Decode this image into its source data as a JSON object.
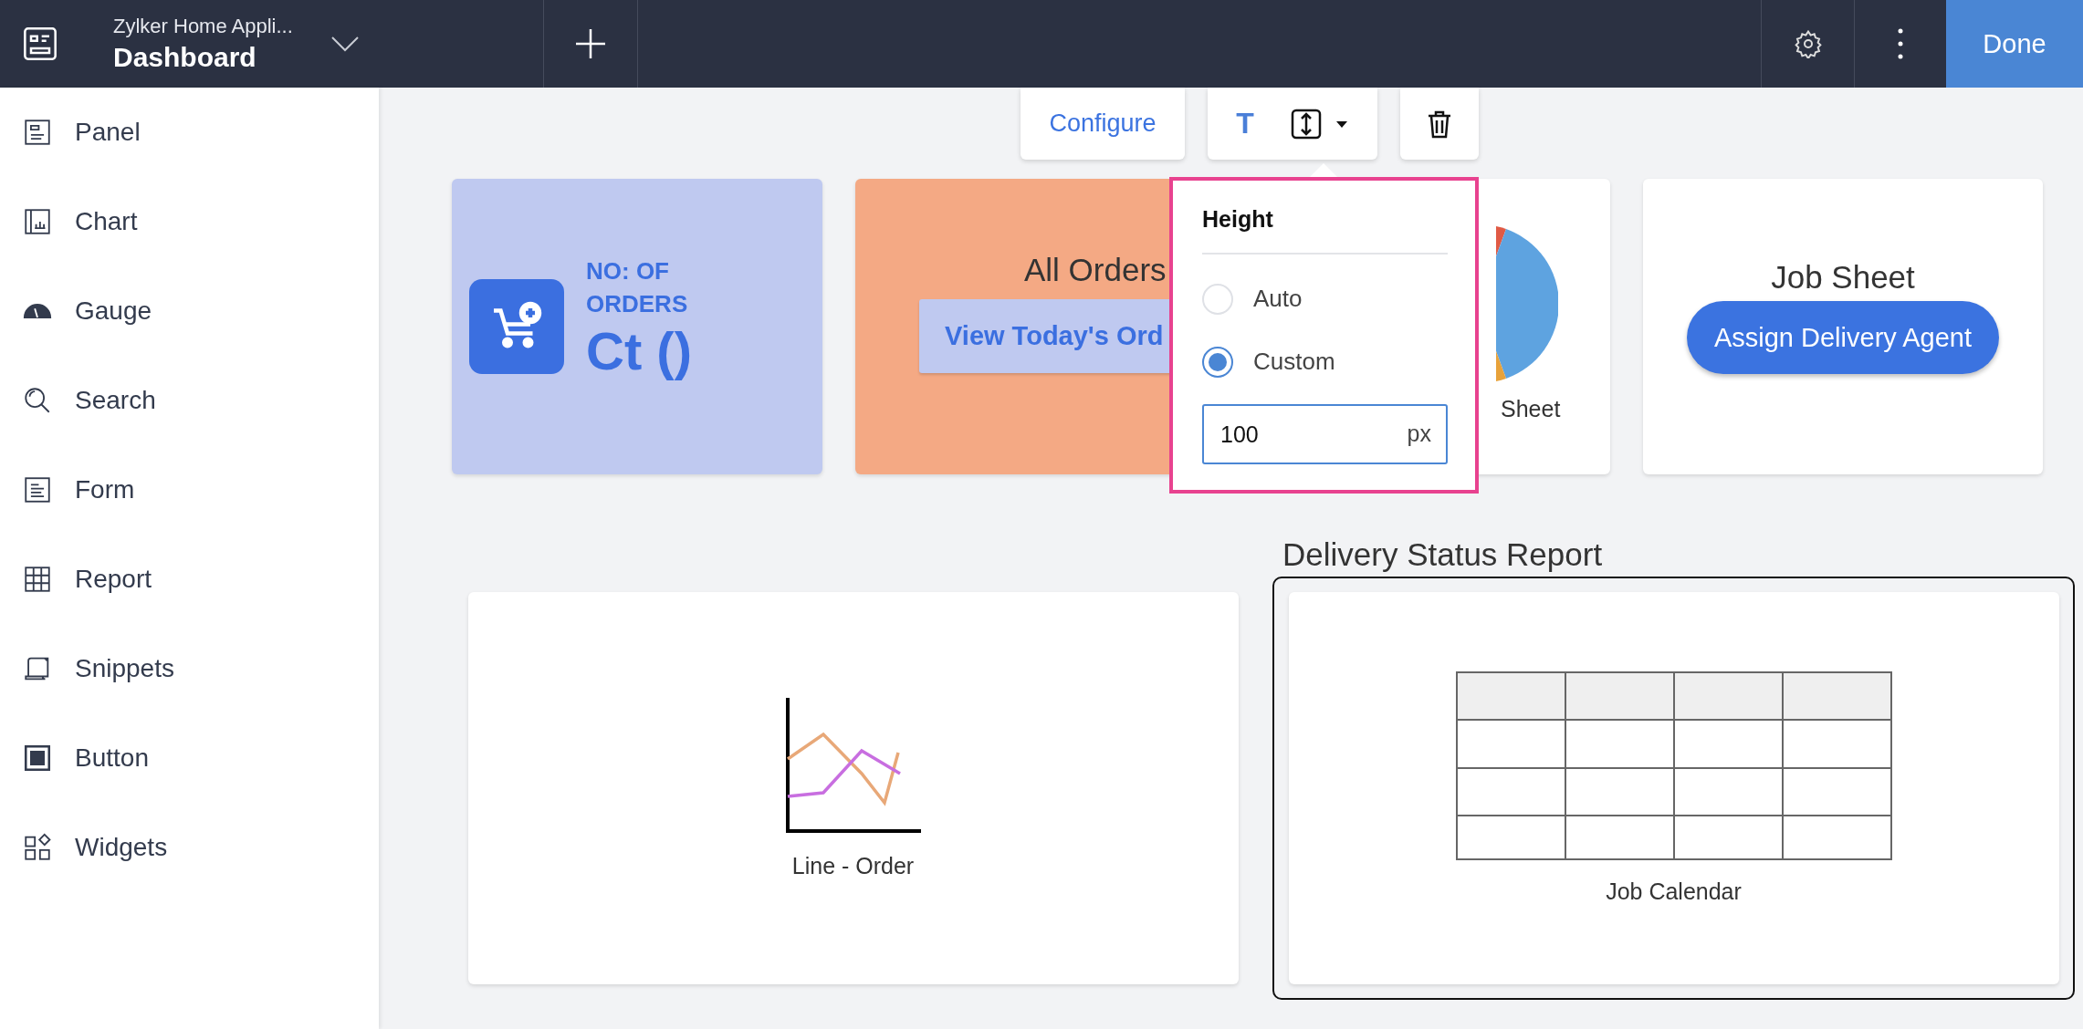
{
  "header": {
    "app_name": "Zylker Home Appli...",
    "page_title": "Dashboard",
    "done_label": "Done"
  },
  "sidebar": {
    "items": [
      {
        "label": "Panel",
        "kind": "panel"
      },
      {
        "label": "Chart",
        "kind": "chart"
      },
      {
        "label": "Gauge",
        "kind": "gauge"
      },
      {
        "label": "Search",
        "kind": "search"
      },
      {
        "label": "Form",
        "kind": "form"
      },
      {
        "label": "Report",
        "kind": "report"
      },
      {
        "label": "Snippets",
        "kind": "snippets"
      },
      {
        "label": "Button",
        "kind": "button"
      },
      {
        "label": "Widgets",
        "kind": "widgets"
      }
    ]
  },
  "toolbar": {
    "configure_label": "Configure",
    "text_label": "T"
  },
  "height_popup": {
    "title": "Height",
    "options": [
      {
        "label": "Auto",
        "selected": false
      },
      {
        "label": "Custom",
        "selected": true
      }
    ],
    "value": "100",
    "unit": "px"
  },
  "widgets": [
    {
      "kind": "metric",
      "color": "#bfc9f0",
      "title": "NO: OF ORDERS",
      "value": "Ct ()"
    },
    {
      "kind": "report_link",
      "color": "#f4a984",
      "title": "All Orders",
      "button": "View Today's Ord"
    },
    {
      "kind": "pie",
      "color": "#ffffff",
      "label": "Sheet"
    },
    {
      "kind": "action",
      "color": "#ffffff",
      "title": "Job Sheet",
      "button": "Assign Delivery Agent"
    }
  ],
  "bottom_row": [
    {
      "kind": "line",
      "label": "Line - Order",
      "selected": false
    },
    {
      "kind": "calendar",
      "section_title": "Delivery Status Report",
      "label": "Job Calendar",
      "selected": true
    }
  ]
}
